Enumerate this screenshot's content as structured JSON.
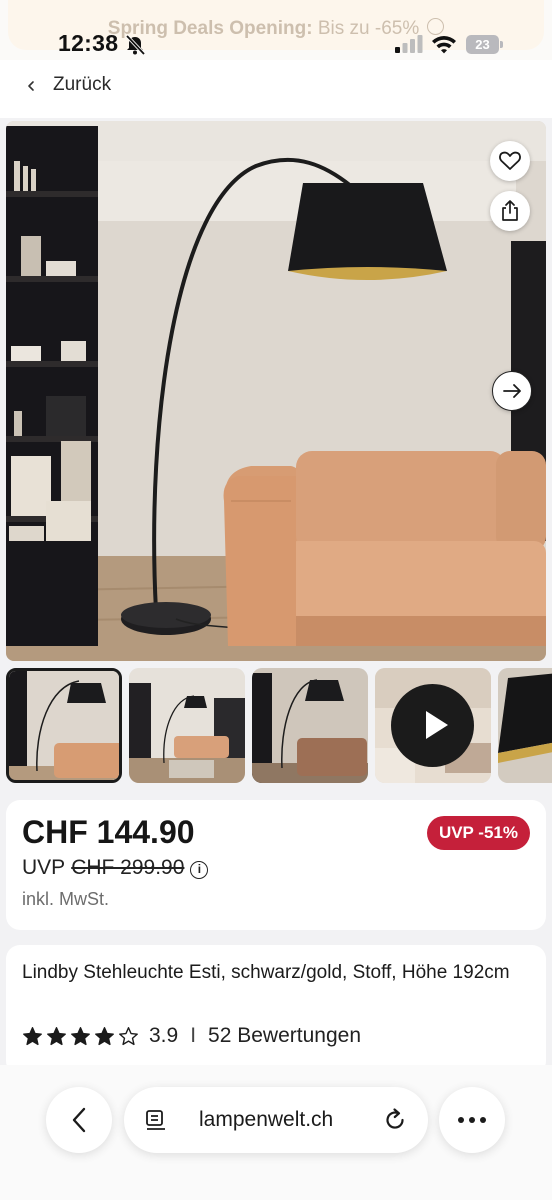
{
  "status_bar": {
    "time": "12:38",
    "battery": "23"
  },
  "banner": {
    "bold": "Spring Deals Opening:",
    "text": "Bis zu -65%"
  },
  "nav": {
    "back_label": "Zurück"
  },
  "gallery": {
    "thumbnails": [
      "thumbnail-1",
      "thumbnail-2",
      "thumbnail-3",
      "thumbnail-video",
      "thumbnail-5"
    ],
    "active_index": 0
  },
  "price": {
    "current": "CHF 144.90",
    "uvp_label": "UVP",
    "uvp_old": "CHF 299.90",
    "info_glyph": "i",
    "tax_note": "inkl. MwSt.",
    "discount_badge": "UVP -51%",
    "badge_color": "#c5203a"
  },
  "product": {
    "title": "Lindby Stehleuchte Esti, schwarz/gold, Stoff, Höhe 192cm",
    "rating": "3.9",
    "rating_stars": 4,
    "separator": "I",
    "reviews": "52 Bewertungen"
  },
  "browser": {
    "url": "lampenwelt.ch"
  }
}
